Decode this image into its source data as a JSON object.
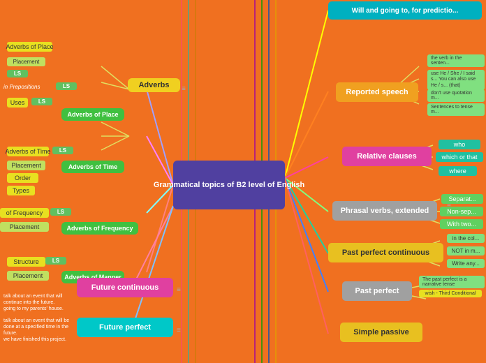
{
  "central": {
    "label": "Grammatical topics of B2 level of English"
  },
  "nodes": {
    "adverbs": "Adverbs",
    "adverbs_of_place": "Adverbs of Place",
    "adverbs_of_time": "Adverbs of Time",
    "adverbs_of_frequency": "Adverbs of Frequency",
    "adverbs_of_manner": "Adverbs of Manner",
    "future_continuous": "Future continuous",
    "future_perfect": "Future perfect",
    "will_going_to": "Will and going to, for predictio...",
    "reported_speech": "Reported speech",
    "relative_clauses": "Relative clauses",
    "phrasal_verbs": "Phrasal verbs, extended",
    "past_perfect_continuous": "Past perfect continuous",
    "past_perfect": "Past perfect",
    "simple_passive": "Simple passive",
    "placement_1": "Placement",
    "uses_1": "Uses",
    "placement_2": "Placement",
    "order": "Order",
    "types": "Types",
    "of_frequency": "of Frequency",
    "placement_3": "Placement",
    "structure": "Structure",
    "placement_4": "Placement",
    "adverbs_of_place_label": "Adverbs of Place",
    "who": "who",
    "which_or_that": "which or that",
    "where": "where",
    "the_verb": "the verb in the senten...",
    "use_he": "use He / She / I said s... You can also use He / s... (that)",
    "dont_use": "don't use quotation m...",
    "sentences": "Sentences to tense m...",
    "in_the_col": "in the col...",
    "not_in": "NOT in m...",
    "write_any": "Write any...",
    "the_past_perfect": "The past perfect is a narrative tense",
    "wish_third": "wish - Third Conditional",
    "separate": "Separat...",
    "non_sep": "Non-sep...",
    "with_two": "With two..."
  },
  "colors": {
    "orange_bg": "#f07020",
    "central_bg": "#5040a0",
    "cyan": "#00c8d0",
    "yellow": "#e8d020",
    "green": "#40c040",
    "pink": "#e040a0",
    "purple": "#8040c0",
    "light_green": "#80e080",
    "blue_gray": "#6090c0"
  }
}
